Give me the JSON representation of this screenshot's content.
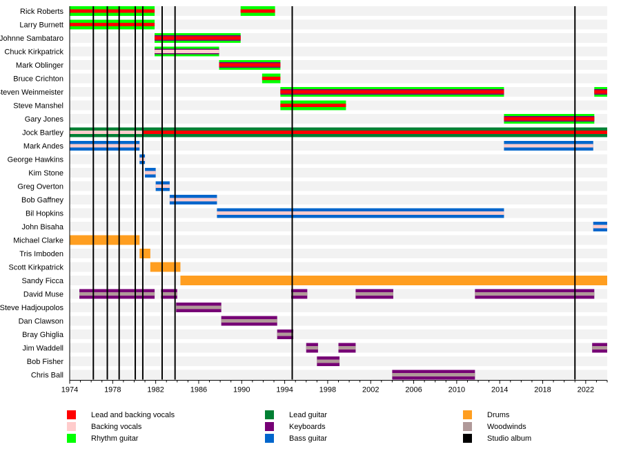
{
  "chart_data": {
    "type": "timeline",
    "title": "",
    "xlabel": "",
    "ylabel": "",
    "xlim": [
      1974,
      2024
    ],
    "x_ticks": [
      1974,
      1978,
      1982,
      1986,
      1990,
      1994,
      1998,
      2002,
      2006,
      2010,
      2014,
      2018,
      2022
    ],
    "grid": false,
    "legend_placement": "bottom",
    "roles": {
      "lead_backing_vocals": {
        "label": "Lead and backing vocals",
        "color": "#ff0000"
      },
      "backing_vocals": {
        "label": "Backing vocals",
        "color": "#ffcccc"
      },
      "rhythm_guitar": {
        "label": "Rhythm guitar",
        "color": "#00ff00"
      },
      "lead_guitar": {
        "label": "Lead guitar",
        "color": "#007f33"
      },
      "keyboards": {
        "label": "Keyboards",
        "color": "#760075"
      },
      "bass_guitar": {
        "label": "Bass guitar",
        "color": "#0066cc"
      },
      "drums": {
        "label": "Drums",
        "color": "#ff9e20"
      },
      "woodwinds": {
        "label": "Woodwinds",
        "color": "#b09999"
      },
      "studio_album": {
        "label": "Studio album",
        "color": "#000000"
      }
    },
    "legend_columns": [
      [
        "lead_backing_vocals",
        "backing_vocals",
        "rhythm_guitar"
      ],
      [
        "lead_guitar",
        "keyboards",
        "bass_guitar"
      ],
      [
        "drums",
        "woodwinds",
        "studio_album"
      ]
    ],
    "studio_albums": [
      1976.2,
      1977.5,
      1978.6,
      1980.1,
      1980.8,
      1982.6,
      1983.8,
      1994.7,
      2021.0
    ],
    "members": [
      {
        "name": "Rick Roberts",
        "spans": [
          {
            "start": 1974,
            "end": 1981.9,
            "outer": "rhythm_guitar",
            "inner": "lead_backing_vocals"
          },
          {
            "start": 1989.9,
            "end": 1993.1,
            "outer": "rhythm_guitar",
            "inner": "lead_backing_vocals"
          }
        ]
      },
      {
        "name": "Larry Burnett",
        "spans": [
          {
            "start": 1974,
            "end": 1981.9,
            "outer": "rhythm_guitar",
            "inner": "lead_backing_vocals"
          }
        ]
      },
      {
        "name": "Johnne Sambataro",
        "spans": [
          {
            "start": 1981.9,
            "end": 1989.9,
            "outer": "rhythm_guitar",
            "mid": "keyboards",
            "inner": "lead_backing_vocals"
          }
        ]
      },
      {
        "name": "Chuck Kirkpatrick",
        "spans": [
          {
            "start": 1981.9,
            "end": 1987.9,
            "outer": "rhythm_guitar",
            "mid": "keyboards",
            "inner": "backing_vocals"
          }
        ]
      },
      {
        "name": "Mark Oblinger",
        "spans": [
          {
            "start": 1987.9,
            "end": 1993.6,
            "outer": "rhythm_guitar",
            "mid": "keyboards",
            "inner": "lead_backing_vocals"
          }
        ]
      },
      {
        "name": "Bruce Crichton",
        "spans": [
          {
            "start": 1991.9,
            "end": 1993.6,
            "outer": "rhythm_guitar",
            "inner": "lead_backing_vocals"
          }
        ]
      },
      {
        "name": "Steven Weinmeister",
        "spans": [
          {
            "start": 1993.6,
            "end": 2014.4,
            "outer": "rhythm_guitar",
            "mid": "keyboards",
            "inner": "lead_backing_vocals"
          },
          {
            "start": 2022.8,
            "end": 2024,
            "outer": "rhythm_guitar",
            "mid": "keyboards",
            "inner": "lead_backing_vocals"
          }
        ]
      },
      {
        "name": "Steve Manshel",
        "spans": [
          {
            "start": 1993.6,
            "end": 1999.7,
            "outer": "rhythm_guitar",
            "inner": "lead_backing_vocals"
          }
        ]
      },
      {
        "name": "Gary Jones",
        "spans": [
          {
            "start": 2014.4,
            "end": 2022.8,
            "outer": "rhythm_guitar",
            "mid": "keyboards",
            "inner": "lead_backing_vocals"
          }
        ]
      },
      {
        "name": "Jock Bartley",
        "spans": [
          {
            "start": 1974,
            "end": 1980.8,
            "outer": "lead_guitar",
            "inner": "backing_vocals"
          },
          {
            "start": 1980.8,
            "end": 2024,
            "outer": "lead_guitar",
            "inner": "lead_backing_vocals"
          }
        ]
      },
      {
        "name": "Mark Andes",
        "spans": [
          {
            "start": 1974,
            "end": 1980.5,
            "outer": "bass_guitar",
            "inner": "backing_vocals"
          },
          {
            "start": 2014.4,
            "end": 2022.7,
            "outer": "bass_guitar",
            "inner": "backing_vocals"
          }
        ]
      },
      {
        "name": "George Hawkins",
        "spans": [
          {
            "start": 1980.5,
            "end": 1981.0,
            "outer": "bass_guitar",
            "inner": "backing_vocals"
          }
        ]
      },
      {
        "name": "Kim Stone",
        "spans": [
          {
            "start": 1981.0,
            "end": 1982.0,
            "outer": "bass_guitar",
            "inner": "backing_vocals"
          }
        ]
      },
      {
        "name": "Greg Overton",
        "spans": [
          {
            "start": 1982.0,
            "end": 1983.3,
            "outer": "bass_guitar",
            "inner": "backing_vocals"
          }
        ]
      },
      {
        "name": "Bob Gaffney",
        "spans": [
          {
            "start": 1983.3,
            "end": 1987.7,
            "outer": "bass_guitar",
            "inner": "backing_vocals"
          }
        ]
      },
      {
        "name": "Bil Hopkins",
        "spans": [
          {
            "start": 1987.7,
            "end": 2014.4,
            "outer": "bass_guitar",
            "inner": "backing_vocals"
          }
        ]
      },
      {
        "name": "John Bisaha",
        "spans": [
          {
            "start": 2022.7,
            "end": 2024,
            "outer": "bass_guitar",
            "inner": "backing_vocals"
          }
        ]
      },
      {
        "name": "Michael Clarke",
        "spans": [
          {
            "start": 1974,
            "end": 1980.5,
            "outer": "drums"
          }
        ]
      },
      {
        "name": "Tris Imboden",
        "spans": [
          {
            "start": 1980.5,
            "end": 1981.5,
            "outer": "drums"
          }
        ]
      },
      {
        "name": "Scott Kirkpatrick",
        "spans": [
          {
            "start": 1981.5,
            "end": 1984.3,
            "outer": "drums"
          }
        ]
      },
      {
        "name": "Sandy Ficca",
        "spans": [
          {
            "start": 1984.3,
            "end": 2024,
            "outer": "drums"
          }
        ]
      },
      {
        "name": "David Muse",
        "spans": [
          {
            "start": 1974.9,
            "end": 1981.9,
            "outer": "keyboards",
            "inner": "woodwinds"
          },
          {
            "start": 1982.5,
            "end": 1984.0,
            "outer": "keyboards",
            "inner": "woodwinds"
          },
          {
            "start": 1994.6,
            "end": 1996.1,
            "outer": "keyboards",
            "inner": "woodwinds"
          },
          {
            "start": 2000.6,
            "end": 2004.1,
            "outer": "keyboards",
            "inner": "woodwinds"
          },
          {
            "start": 2011.7,
            "end": 2022.8,
            "outer": "keyboards",
            "inner": "woodwinds"
          }
        ]
      },
      {
        "name": "Steve Hadjoupolos",
        "spans": [
          {
            "start": 1983.9,
            "end": 1988.1,
            "outer": "keyboards",
            "inner": "woodwinds"
          }
        ]
      },
      {
        "name": "Dan Clawson",
        "spans": [
          {
            "start": 1988.1,
            "end": 1993.3,
            "outer": "keyboards",
            "inner": "woodwinds"
          }
        ]
      },
      {
        "name": "Bray Ghiglia",
        "spans": [
          {
            "start": 1993.3,
            "end": 1994.8,
            "outer": "keyboards",
            "inner": "woodwinds"
          }
        ]
      },
      {
        "name": "Jim Waddell",
        "spans": [
          {
            "start": 1996.0,
            "end": 1997.1,
            "outer": "keyboards",
            "inner": "woodwinds"
          },
          {
            "start": 1999.0,
            "end": 2000.6,
            "outer": "keyboards",
            "inner": "woodwinds"
          },
          {
            "start": 2022.6,
            "end": 2024,
            "outer": "keyboards",
            "inner": "woodwinds"
          }
        ]
      },
      {
        "name": "Bob Fisher",
        "spans": [
          {
            "start": 1997.0,
            "end": 1999.1,
            "outer": "keyboards",
            "inner": "woodwinds"
          }
        ]
      },
      {
        "name": "Chris Ball",
        "spans": [
          {
            "start": 2004.0,
            "end": 2011.7,
            "outer": "keyboards",
            "inner": "woodwinds"
          }
        ]
      }
    ]
  }
}
